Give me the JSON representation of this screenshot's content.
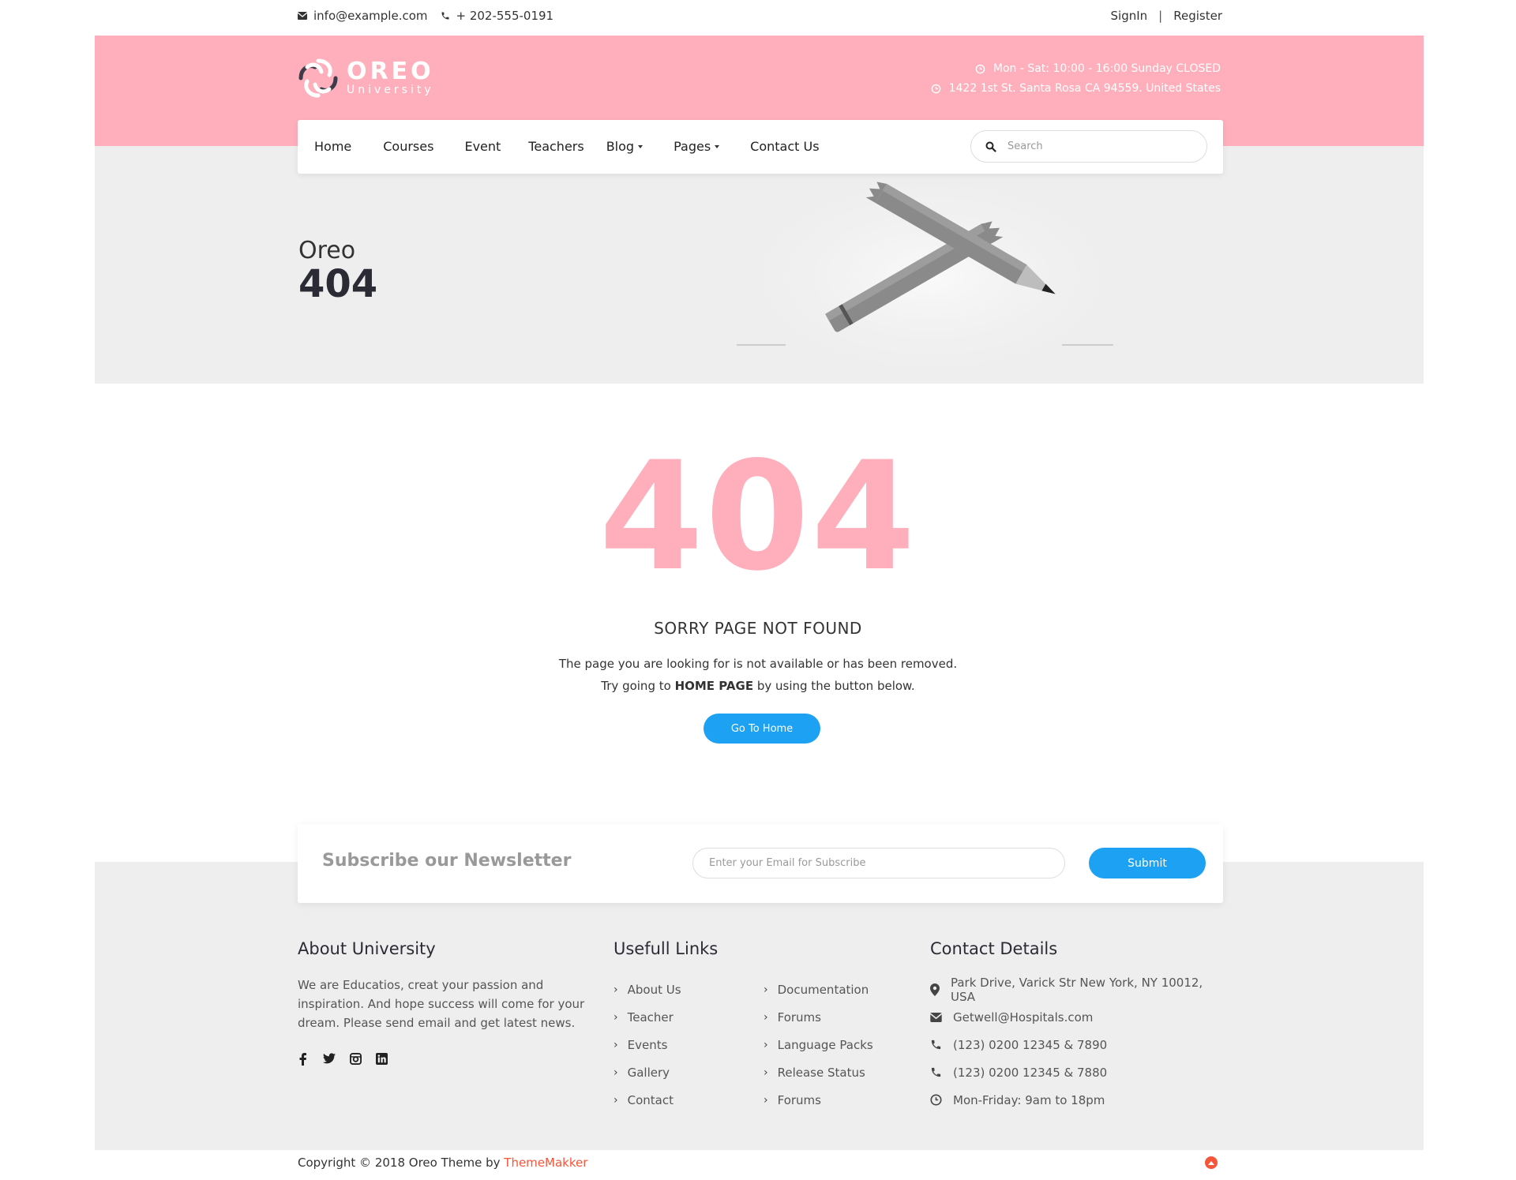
{
  "topbar": {
    "email": "info@example.com",
    "phone": "+ 202-555-0191",
    "signin": "SignIn",
    "separator": "|",
    "register": "Register"
  },
  "header": {
    "logo_main": "OREO",
    "logo_sub": "University",
    "hours": "Mon - Sat: 10:00 - 16:00 Sunday CLOSED",
    "address": "1422 1st St. Santa Rosa CA 94559. United States"
  },
  "nav": {
    "items": [
      {
        "label": "Home"
      },
      {
        "label": "Courses"
      },
      {
        "label": "Event"
      },
      {
        "label": "Teachers"
      },
      {
        "label": "Blog"
      },
      {
        "label": "Pages"
      },
      {
        "label": "Contact Us"
      }
    ],
    "search_placeholder": "Search"
  },
  "hero": {
    "title": "Oreo",
    "subtitle": "404"
  },
  "error": {
    "code": "404",
    "heading": "SORRY PAGE NOT FOUND",
    "line1": "The page you are looking for is not available or has been removed.",
    "line2_pre": "Try going to",
    "line2_bold": "HOME PAGE",
    "line2_post": "by using the button below.",
    "button": "Go To Home"
  },
  "newsletter": {
    "title": "Subscribe our Newsletter",
    "placeholder": "Enter your Email for Subscribe",
    "button": "Submit"
  },
  "footer": {
    "about": {
      "title": "About University",
      "text": "We are Educatios, creat your passion and inspiration. And hope success will come for your dream. Please send email and get latest news."
    },
    "links": {
      "title": "Usefull Links",
      "col1": [
        "About Us",
        "Teacher",
        "Events",
        "Gallery",
        "Contact"
      ],
      "col2": [
        "Documentation",
        "Forums",
        "Language Packs",
        "Release Status",
        "Forums"
      ]
    },
    "contact": {
      "title": "Contact Details",
      "address": "Park Drive, Varick Str New York, NY 10012, USA",
      "email": "Getwell@Hospitals.com",
      "phone1": "(123) 0200 12345 & 7890",
      "phone2": "(123) 0200 12345 & 7880",
      "hours": "Mon-Friday: 9am to 18pm"
    },
    "copyright_pre": "Copyright © 2018 Oreo Theme by",
    "copyright_link": "ThemeMakker"
  },
  "colors": {
    "brand_pink": "#ffafbc",
    "accent_blue": "#1da1f2",
    "link_orange": "#f5563a"
  }
}
